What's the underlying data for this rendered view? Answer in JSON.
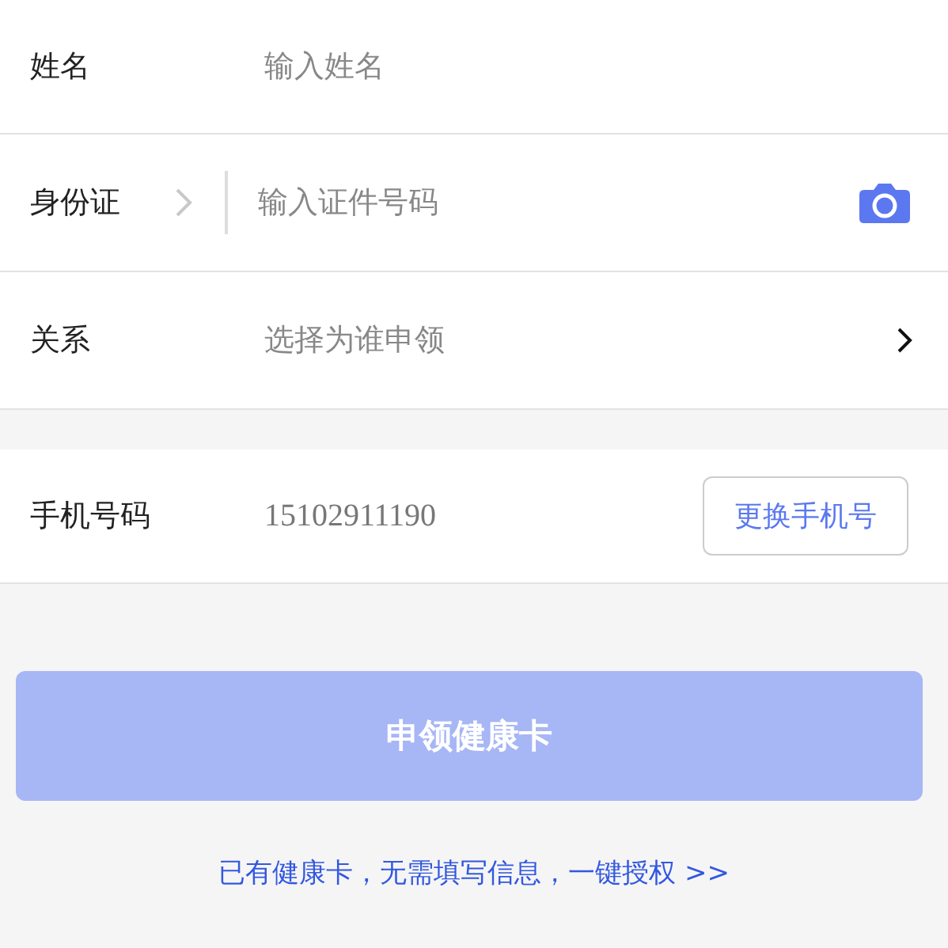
{
  "form": {
    "rows": [
      {
        "kind": "text",
        "label": "姓名",
        "placeholder": "输入姓名"
      },
      {
        "kind": "id",
        "label": "身份证",
        "placeholder": "输入证件号码"
      },
      {
        "kind": "select",
        "label": "关系",
        "placeholder": "选择为谁申领"
      }
    ]
  },
  "phone": {
    "label": "手机号码",
    "value": "15102911190",
    "button": "更换手机号"
  },
  "submit": {
    "label": "申领健康卡",
    "disabled": true
  },
  "auth_link": "已有健康卡，无需填写信息，一键授权 >>"
}
